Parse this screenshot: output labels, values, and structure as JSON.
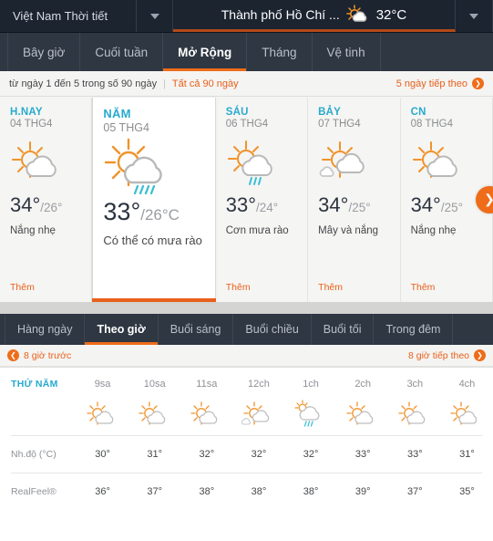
{
  "header": {
    "country_label": "Việt Nam Thời tiết",
    "city_label": "Thành phố Hồ Chí ...",
    "city_temp": "32°C",
    "country_caret_icon": "chevron-down-icon",
    "city_caret_icon": "chevron-down-icon",
    "city_weather_icon": "sun-cloud-icon"
  },
  "nav_tabs": [
    {
      "label": "Bây giờ",
      "active": false
    },
    {
      "label": "Cuối tuần",
      "active": false
    },
    {
      "label": "Mở Rộng",
      "active": true
    },
    {
      "label": "Tháng",
      "active": false
    },
    {
      "label": "Vệ tinh",
      "active": false
    }
  ],
  "range_bar": {
    "text": "từ ngày 1 đến 5 trong số 90 ngày",
    "separator": "|",
    "all_link": "Tất cả 90 ngày",
    "next_link": "5 ngày tiếp theo",
    "next_icon": "arrow-right-circle-icon"
  },
  "days": [
    {
      "dow": "H.NAY",
      "date": "04 THG4",
      "icon": "sun-cloud-icon",
      "high": "34°",
      "low": "/26°",
      "phrase": "Nắng nhẹ",
      "more": "Thêm",
      "selected": false
    },
    {
      "dow": "NĂM",
      "date": "05 THG4",
      "icon": "sun-cloud-rain-icon",
      "high": "33°",
      "low": "/26°C",
      "phrase": "Có thể có mưa rào",
      "more": "",
      "selected": true
    },
    {
      "dow": "SÁU",
      "date": "06 THG4",
      "icon": "sun-cloud-rain-icon",
      "high": "33°",
      "low": "/24°",
      "phrase": "Cơn mưa rào",
      "more": "Thêm",
      "selected": false
    },
    {
      "dow": "BẢY",
      "date": "07 THG4",
      "icon": "sun-cloud-small-icon",
      "high": "34°",
      "low": "/25°",
      "phrase": "Mây và nắng",
      "more": "Thêm",
      "selected": false
    },
    {
      "dow": "CN",
      "date": "08 THG4",
      "icon": "sun-cloud-icon",
      "high": "34°",
      "low": "/25°",
      "phrase": "Nắng nhẹ",
      "more": "Thêm",
      "selected": false
    }
  ],
  "day_next_arrow_icon": "chevron-right-icon",
  "hourly_tabs": [
    {
      "label": "Hàng ngày",
      "active": false
    },
    {
      "label": "Theo giờ",
      "active": true
    },
    {
      "label": "Buổi sáng",
      "active": false
    },
    {
      "label": "Buổi chiều",
      "active": false
    },
    {
      "label": "Buổi tối",
      "active": false
    },
    {
      "label": "Trong đêm",
      "active": false
    }
  ],
  "hourly_range": {
    "prev_label": "8 giờ trước",
    "next_label": "8 giờ tiếp theo",
    "prev_icon": "arrow-left-circle-icon",
    "next_icon": "arrow-right-circle-icon"
  },
  "hourly": {
    "day_label": "THỨ NĂM",
    "times": [
      "9sa",
      "10sa",
      "11sa",
      "12ch",
      "1ch",
      "2ch",
      "3ch",
      "4ch"
    ],
    "icons": [
      "sun-cloud-icon",
      "sun-cloud-icon",
      "sun-cloud-icon",
      "sun-cloud-small-icon",
      "sun-cloud-rain-icon",
      "sun-cloud-icon",
      "sun-cloud-icon",
      "sun-cloud-icon"
    ],
    "temp_label": "Nh.độ (°C)",
    "temps": [
      "30°",
      "31°",
      "32°",
      "32°",
      "32°",
      "33°",
      "33°",
      "31°"
    ],
    "realfeel_label": "RealFeel®",
    "realfeel": [
      "36°",
      "37°",
      "38°",
      "38°",
      "38°",
      "39°",
      "37°",
      "35°"
    ]
  },
  "colors": {
    "accent_orange": "#ef6c1a",
    "link_orange": "#e8601c",
    "cyan": "#27aacd",
    "dark_nav": "#2e3742",
    "dark_header": "#1c2430"
  }
}
